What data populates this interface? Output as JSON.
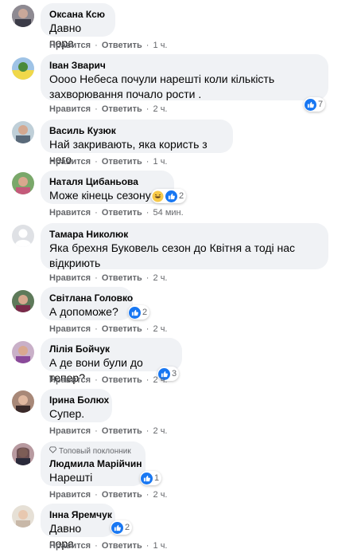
{
  "actions": {
    "like": "Нравится",
    "reply": "Ответить",
    "dot": "·"
  },
  "comments": [
    {
      "name": "Оксана Ксю",
      "text": "Давно пора",
      "time": "1 ч."
    },
    {
      "name": "Іван Зварич",
      "text": "Оооо Небеса почули нарешті коли кількість захворювання почало рости .",
      "time": "2 ч.",
      "reactions": "7"
    },
    {
      "name": "Василь Кузюк",
      "text": "Най закривають, яка користь з него",
      "time": "1 ч."
    },
    {
      "name": "Наталя Цибаньова",
      "text": "Може кінець сезону?",
      "time": "54 мин.",
      "reactions": "2"
    },
    {
      "name": "Тамара Николюк",
      "text": "Яка брехня Буковель сезон до Квітня а тоді нас відкриють",
      "time": "2 ч."
    },
    {
      "name": "Світлана Головко",
      "text": "А допоможе?",
      "time": "2 ч.",
      "reactions": "2"
    },
    {
      "name": "Лілія Бойчук",
      "text": "А де вони були до тепер?",
      "time": "2 ч.",
      "reactions": "3"
    },
    {
      "name": "Ірина Болюх",
      "text": "Супер.",
      "time": "2 ч."
    },
    {
      "name": "Людмила Марійчин",
      "badge": "Топовый поклонник",
      "text": "Нарешті",
      "time": "2 ч.",
      "reactions": "1"
    },
    {
      "name": "Інна Яремчук",
      "text": "Давно пора",
      "time": "1 ч.",
      "reactions": "2"
    }
  ],
  "colors": {
    "bubble": "#f0f2f5",
    "like": "#1877f2",
    "meta": "#65676b"
  }
}
